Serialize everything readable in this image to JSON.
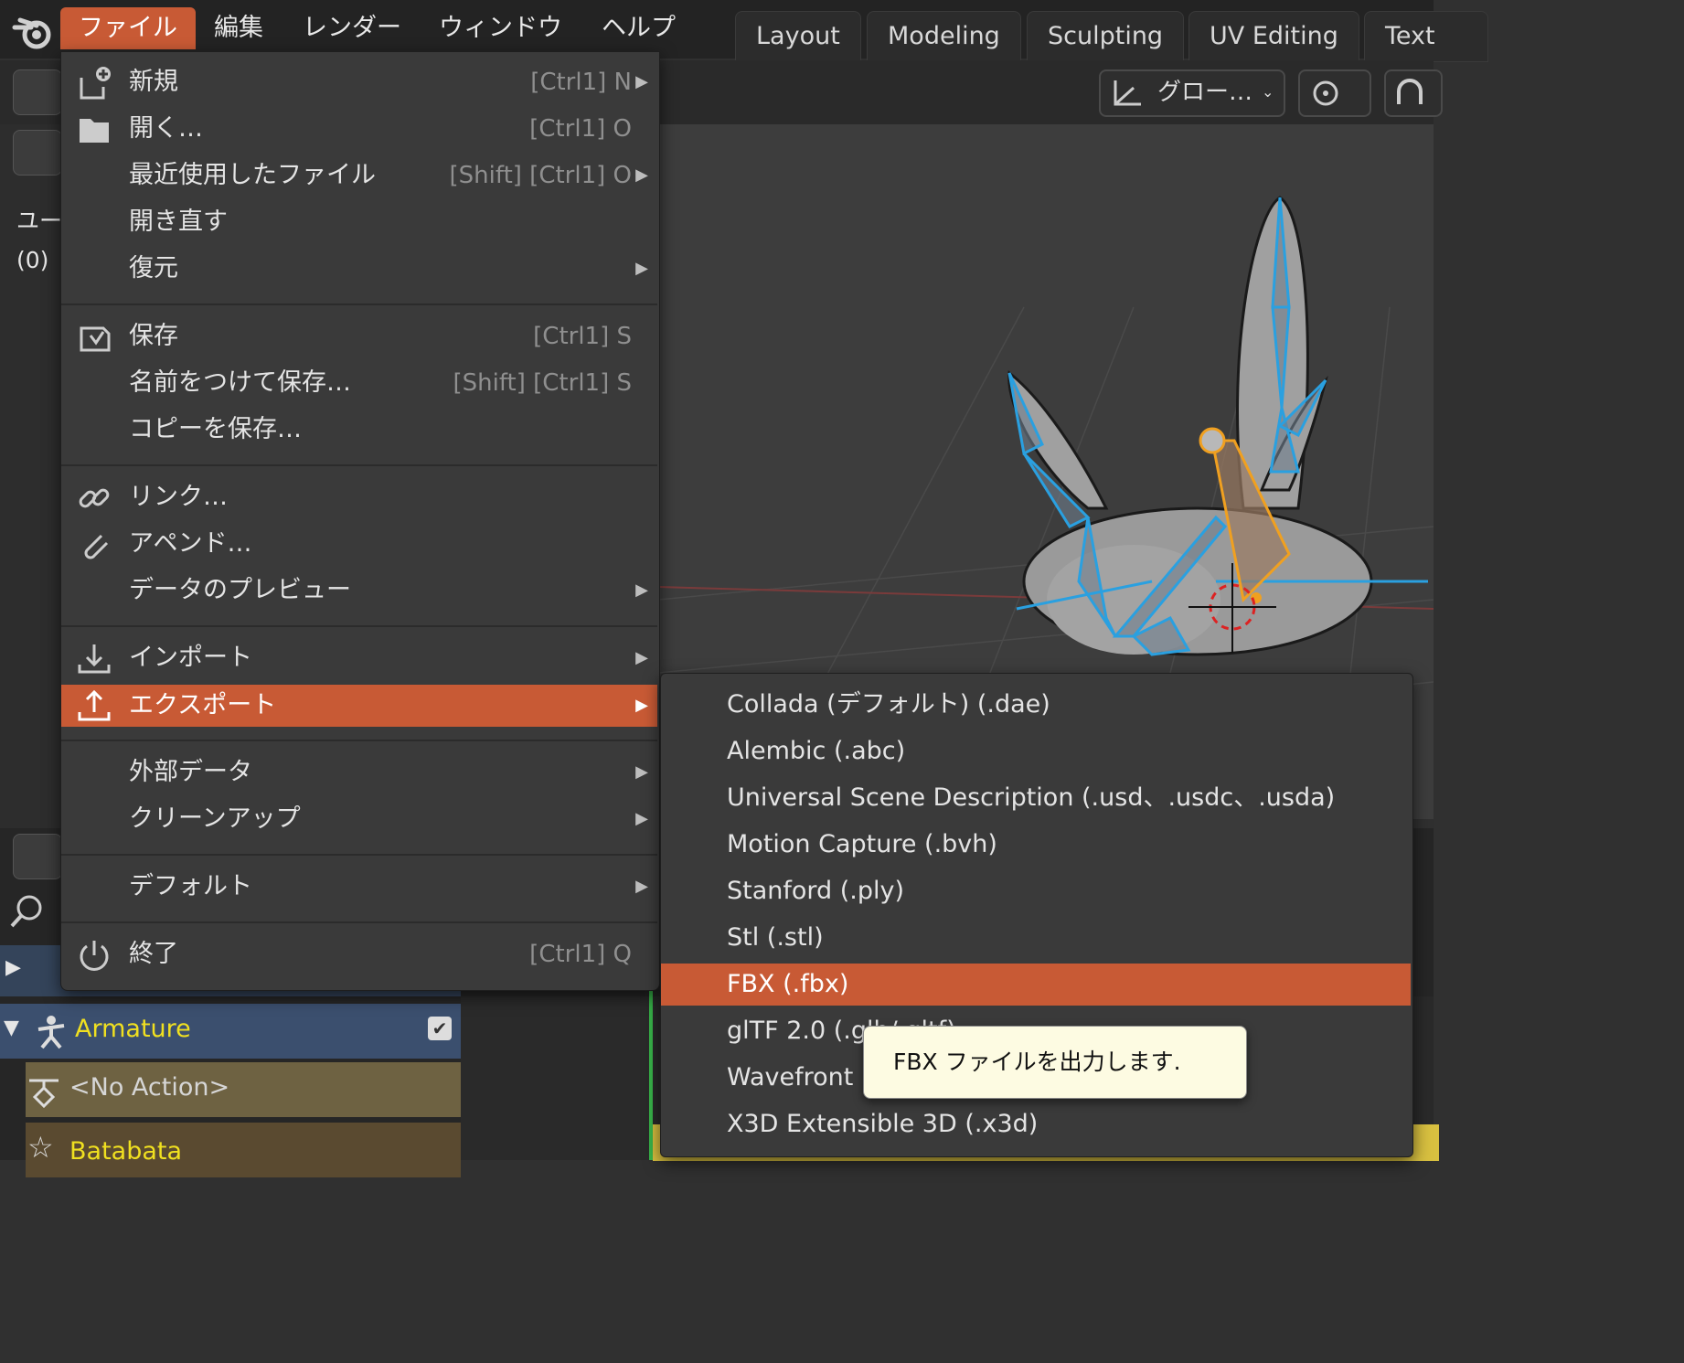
{
  "topbar": {
    "menus": [
      "ファイル",
      "編集",
      "レンダー",
      "ウィンドウ",
      "ヘルプ"
    ],
    "workspaces": [
      "Layout",
      "Modeling",
      "Sculpting",
      "UV Editing",
      "Text"
    ]
  },
  "header": {
    "transform_orientation": "グロー…"
  },
  "viewport_info": {
    "user_label": "ユー",
    "frame_label": "(0)"
  },
  "file_menu": {
    "items": [
      {
        "label": "新規",
        "shortcut": "[Ctrl1] N",
        "arrow": "▶"
      },
      {
        "label": "開く…",
        "shortcut": "[Ctrl1] O",
        "arrow": ""
      },
      {
        "label": "最近使用したファイル",
        "shortcut": "[Shift] [Ctrl1] O",
        "arrow": "▶"
      },
      {
        "label": "開き直す",
        "shortcut": "",
        "arrow": ""
      },
      {
        "label": "復元",
        "shortcut": "",
        "arrow": "▶"
      },
      {
        "label": "保存",
        "shortcut": "[Ctrl1] S",
        "arrow": ""
      },
      {
        "label": "名前をつけて保存…",
        "shortcut": "[Shift] [Ctrl1] S",
        "arrow": ""
      },
      {
        "label": "コピーを保存…",
        "shortcut": "",
        "arrow": ""
      },
      {
        "label": "リンク…",
        "shortcut": "",
        "arrow": ""
      },
      {
        "label": "アペンド…",
        "shortcut": "",
        "arrow": ""
      },
      {
        "label": "データのプレビュー",
        "shortcut": "",
        "arrow": "▶"
      },
      {
        "label": "インポート",
        "shortcut": "",
        "arrow": "▶"
      },
      {
        "label": "エクスポート",
        "shortcut": "",
        "arrow": "▶"
      },
      {
        "label": "外部データ",
        "shortcut": "",
        "arrow": "▶"
      },
      {
        "label": "クリーンアップ",
        "shortcut": "",
        "arrow": "▶"
      },
      {
        "label": "デフォルト",
        "shortcut": "",
        "arrow": "▶"
      },
      {
        "label": "終了",
        "shortcut": "[Ctrl1] Q",
        "arrow": ""
      }
    ]
  },
  "export_menu": {
    "items": [
      "Collada (デフォルト) (.dae)",
      "Alembic (.abc)",
      "Universal Scene Description (.usd、.usdc、.usda)",
      "Motion Capture (.bvh)",
      "Stanford (.ply)",
      "Stl (.stl)",
      "FBX (.fbx)",
      "glTF 2.0 (.glb/.gltf)",
      "Wavefront",
      "X3D Extensible 3D (.x3d)"
    ]
  },
  "tooltip": {
    "text": "FBX ファイルを出力します."
  },
  "outliner": {
    "rows": [
      "Armature",
      "<No Action>",
      "Batabata"
    ]
  },
  "colors": {
    "accent": "#c85a35",
    "armature_text": "#f0e020",
    "bone_selected": "#2aa0e0",
    "bone_active": "#f0a020"
  }
}
